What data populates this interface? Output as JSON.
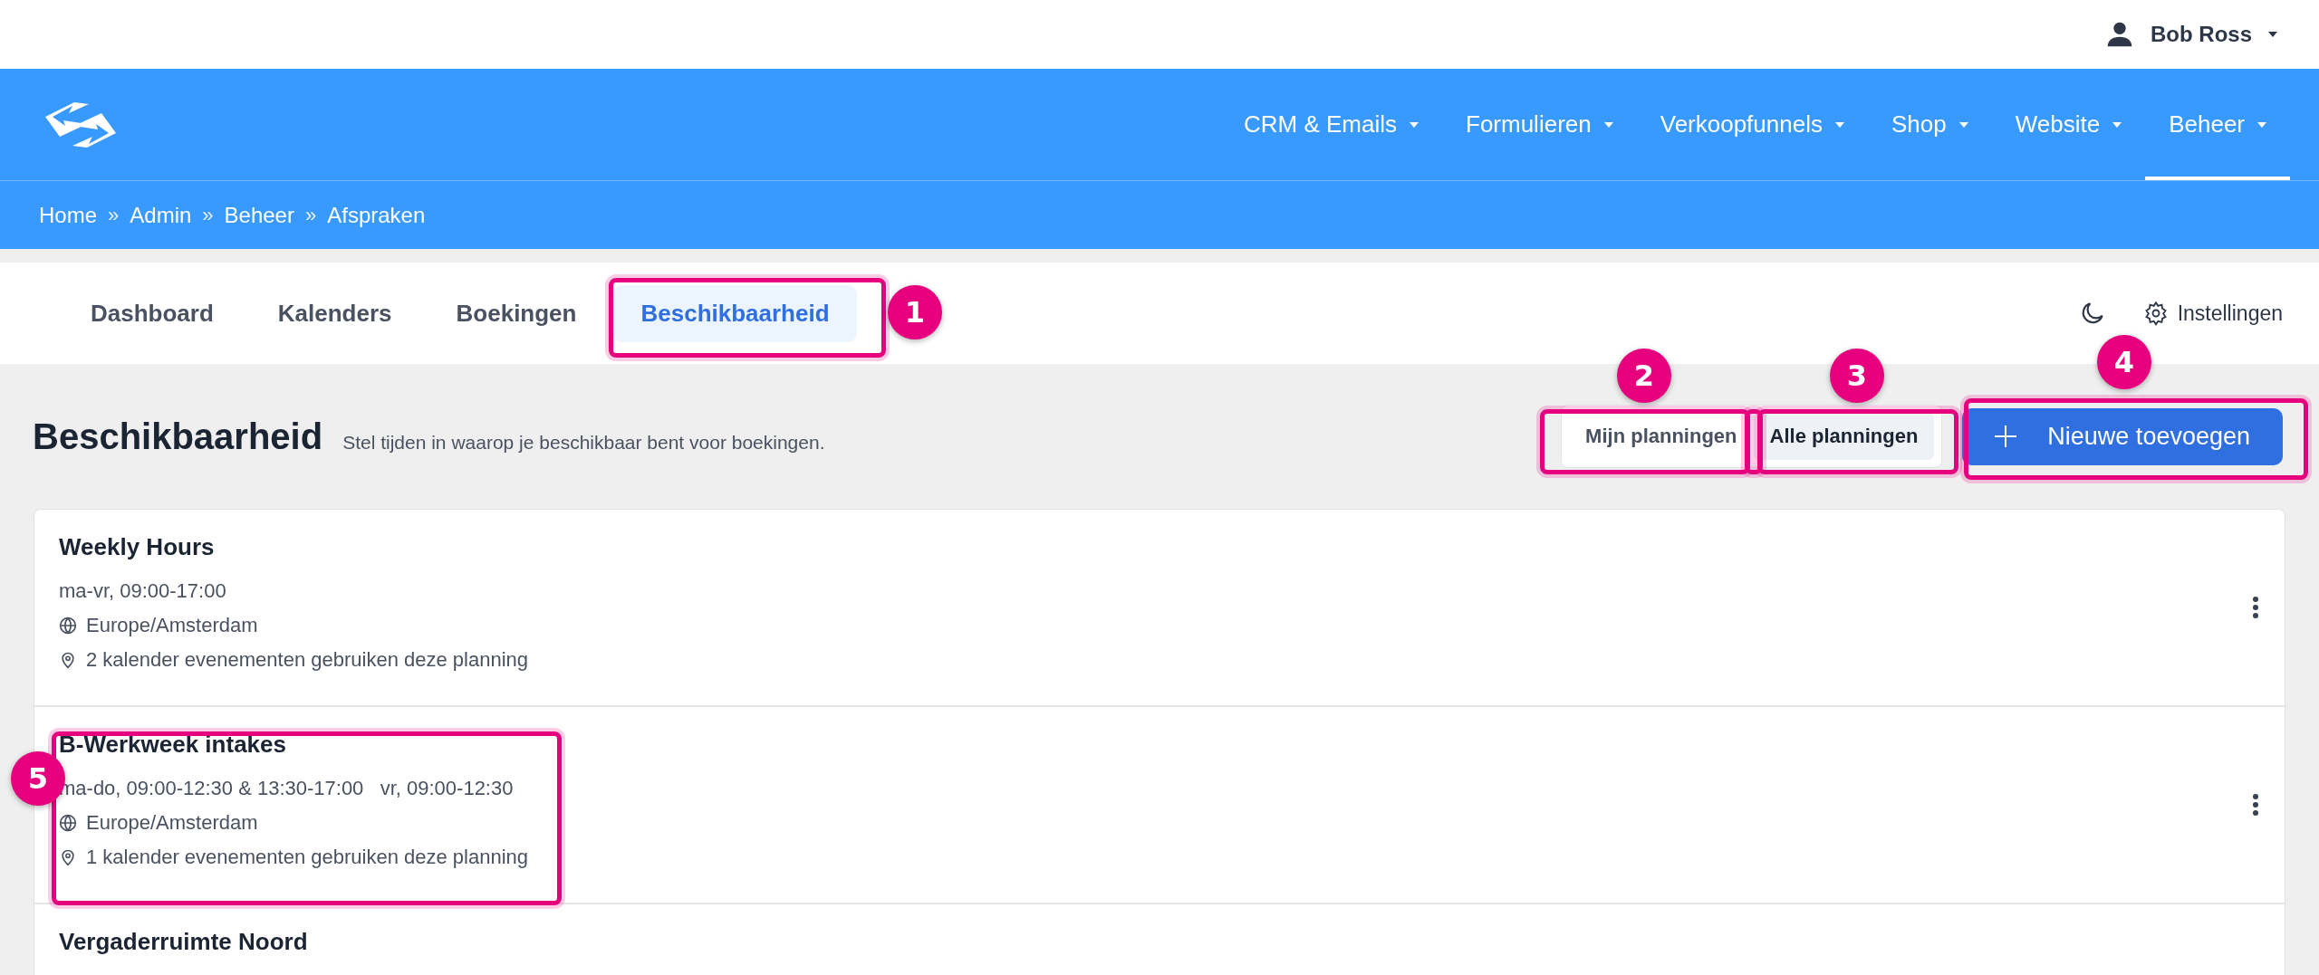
{
  "user_menu": {
    "name": "Bob Ross"
  },
  "main_nav": [
    {
      "label": "CRM & Emails",
      "selected": false
    },
    {
      "label": "Formulieren",
      "selected": false
    },
    {
      "label": "Verkoopfunnels",
      "selected": false
    },
    {
      "label": "Shop",
      "selected": false
    },
    {
      "label": "Website",
      "selected": false
    },
    {
      "label": "Beheer",
      "selected": true
    }
  ],
  "breadcrumb": [
    "Home",
    "Admin",
    "Beheer",
    "Afspraken"
  ],
  "breadcrumb_separator": "»",
  "tabs": [
    {
      "label": "Dashboard",
      "selected": false
    },
    {
      "label": "Kalenders",
      "selected": false
    },
    {
      "label": "Boekingen",
      "selected": false
    },
    {
      "label": "Beschikbaarheid",
      "selected": true
    }
  ],
  "settings_link": "Instellingen",
  "page": {
    "title": "Beschikbaarheid",
    "subtitle": "Stel tijden in waarop je beschikbaar bent voor boekingen."
  },
  "filter": [
    {
      "label": "Mijn planningen",
      "selected": false
    },
    {
      "label": "Alle planningen",
      "selected": true
    }
  ],
  "add_button": "Nieuwe toevoegen",
  "schedules": [
    {
      "title": "Weekly Hours",
      "hours": "ma-vr, 09:00-17:00",
      "timezone": "Europe/Amsterdam",
      "usage": "2 kalender evenementen gebruiken deze planning"
    },
    {
      "title": "B-Werkweek intakes",
      "hours": "ma-do, 09:00-12:30 & 13:30-17:00   vr, 09:00-12:30",
      "timezone": "Europe/Amsterdam",
      "usage": "1 kalender evenementen gebruiken deze planning"
    },
    {
      "title": "Vergaderruimte Noord"
    }
  ],
  "annotations": [
    {
      "label": "1"
    },
    {
      "label": "2"
    },
    {
      "label": "3"
    },
    {
      "label": "4"
    },
    {
      "label": "5"
    }
  ]
}
